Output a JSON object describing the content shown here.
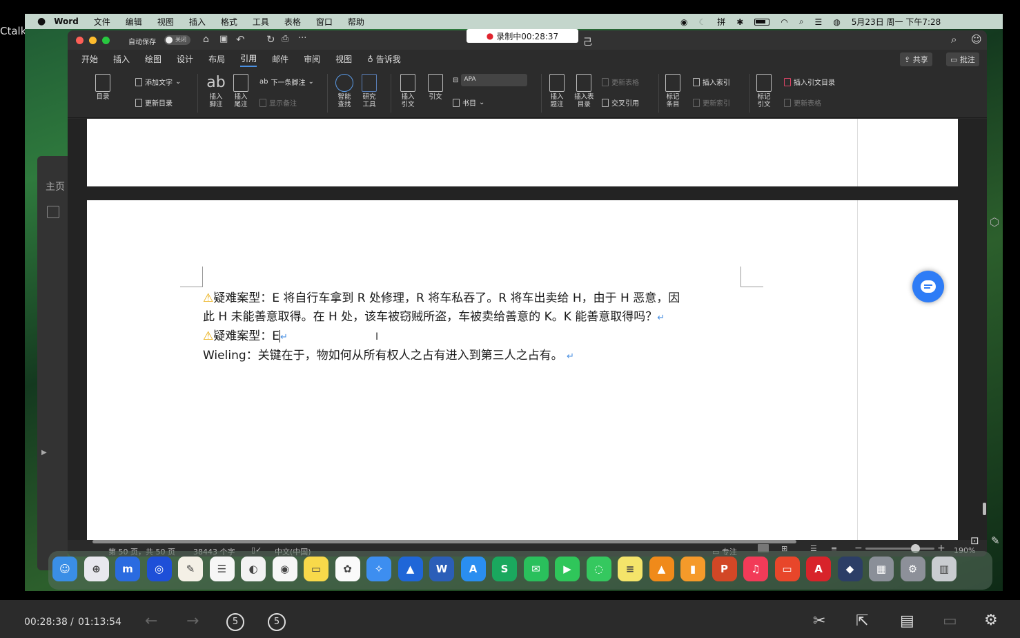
{
  "outer": {
    "left_label": "Ctalk"
  },
  "mac_menubar": {
    "app": "Word",
    "menus": [
      "文件",
      "编辑",
      "视图",
      "插入",
      "格式",
      "工具",
      "表格",
      "窗口",
      "帮助"
    ],
    "datetime": "5月23日 周一 下午7:28"
  },
  "recording": {
    "label": "录制中00:28:37"
  },
  "word": {
    "autosave_label": "自动保存",
    "autosave_state": "关闭",
    "title_suffix": "己",
    "tabs": [
      "开始",
      "插入",
      "绘图",
      "设计",
      "布局",
      "引用",
      "邮件",
      "审阅",
      "视图"
    ],
    "tab_partial": "开始",
    "tell_me": "告诉我",
    "share_label": "共享",
    "comments_label": "批注",
    "ribbon": {
      "toc": "目录",
      "add_text": "添加文字",
      "update_toc": "更新目录",
      "insert_footnote": "插入\n脚注",
      "insert_endnote": "插入\n尾注",
      "next_footnote": "下一条脚注",
      "show_notes": "显示备注",
      "smart_lookup": "智能\n查找",
      "researcher": "研究\n工具",
      "insert_citation": "插入\n引文",
      "citations": "引文",
      "style_value": "APA",
      "bibliography": "书目",
      "insert_caption": "插入\n题注",
      "insert_table_figures": "插入表\n目录",
      "update_table": "更新表格",
      "cross_ref": "交叉引用",
      "mark_entry": "标记\n条目",
      "insert_index": "插入索引",
      "update_index": "更新索引",
      "mark_citation": "标记\n引文",
      "insert_toa": "插入引文目录",
      "update_table2": "更新表格"
    },
    "left_panel": {
      "label": "主页"
    },
    "document": {
      "line1": "疑难案型：E 将自行车拿到 R 处修理，R 将车私吞了。R 将车出卖给 H，由于 H 恶意，因",
      "line2": "此 H 未能善意取得。在 H 处，该车被窃贼所盗，车被卖给善意的 K。K 能善意取得吗？",
      "line3_prefix": "疑难案型：",
      "line3_typed": "E",
      "line4": "Wieling：关键在于，物如何从所有权人之占有进入到第三人之占有。",
      "para_mark": "↵",
      "warn_glyph": "⚠"
    },
    "status": {
      "page": "第 50 页，共 50 页",
      "words": "38443 个字",
      "language": "中文(中国)",
      "focus": "专注",
      "zoom": "190%",
      "zoom_level": 0.72
    }
  },
  "dock": {
    "icons": [
      "finder",
      "launchpad",
      "app-m",
      "app-circle",
      "pages-pen",
      "reminders",
      "app-white",
      "chrome",
      "notes",
      "photos",
      "safari",
      "app-mountain",
      "word",
      "appstore",
      "app-s",
      "wechat",
      "facetime",
      "messages",
      "stickies",
      "vlc",
      "books",
      "powerpoint",
      "music",
      "app-box",
      "acrobat",
      "app-cube",
      "app-grid",
      "system-prefs",
      "trash"
    ]
  },
  "player": {
    "current": "00:28:38",
    "separator": "/",
    "total": "01:13:54",
    "progress": 0.383,
    "back_seconds": "5",
    "forward_seconds": "5"
  },
  "colors": {
    "accent_blue": "#2e7cf6",
    "progress_green": "#1ec05a",
    "warning": "#f0c020",
    "rec_red": "#e0242e"
  }
}
